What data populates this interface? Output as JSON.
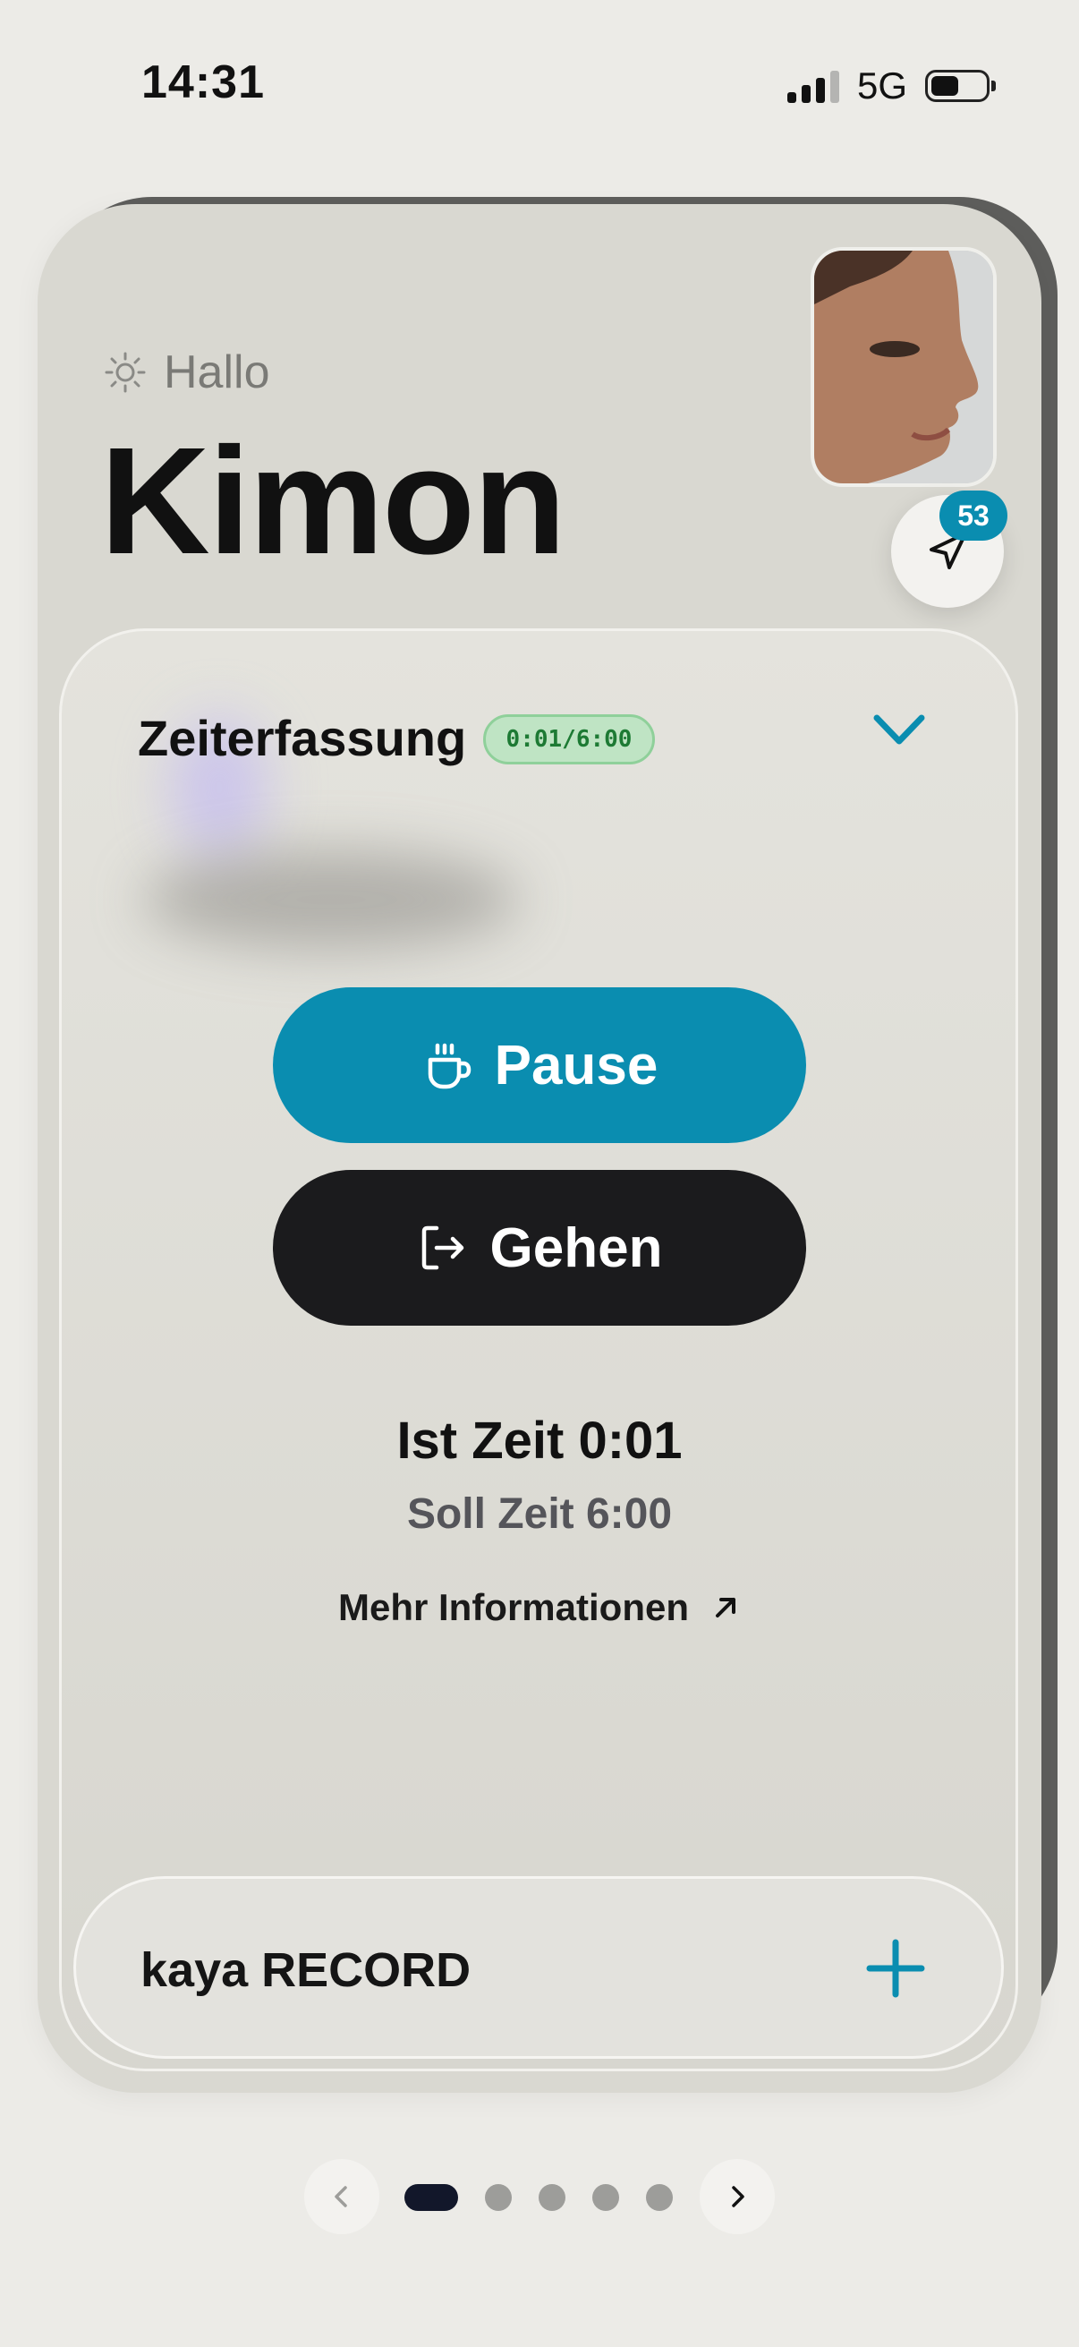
{
  "status_bar": {
    "time": "14:31",
    "network": "5G",
    "battery_level": 0.4
  },
  "header": {
    "greeting": "Hallo",
    "user_name": "Kimon",
    "message_badge_count": "53"
  },
  "time_tracking": {
    "title": "Zeiterfassung",
    "time_badge": "0:01/6:00",
    "pause_label": "Pause",
    "leave_label": "Gehen",
    "actual_time": "Ist Zeit 0:01",
    "target_time": "Soll Zeit 6:00",
    "more_info": "Mehr Informationen"
  },
  "record_section": {
    "label": "kaya RECORD"
  },
  "pager": {
    "page_count": 5,
    "active_index": 0
  },
  "colors": {
    "accent": "#0a8db0",
    "dark_button": "#1b1b1d",
    "badge_green_bg": "#bfe4c4",
    "badge_green_text": "#1d7a34",
    "background": "#ecebe7"
  }
}
